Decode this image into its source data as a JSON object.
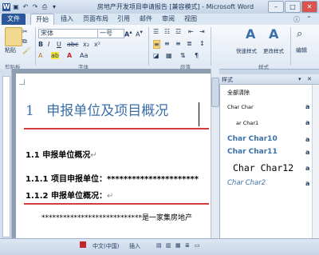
{
  "window": {
    "title": "房地产开发项目申请报告 [兼容模式] - Microsoft Word"
  },
  "quick_access": [
    "word-logo-icon",
    "save-icon",
    "undo-icon",
    "redo-icon",
    "print-icon",
    "customize-icon"
  ],
  "tabs": [
    {
      "label": "文件",
      "active": false
    },
    {
      "label": "开始",
      "active": true
    },
    {
      "label": "插入",
      "active": false
    },
    {
      "label": "页面布局",
      "active": false
    },
    {
      "label": "引用",
      "active": false
    },
    {
      "label": "邮件",
      "active": false
    },
    {
      "label": "审阅",
      "active": false
    },
    {
      "label": "视图",
      "active": false
    }
  ],
  "ribbon": {
    "clipboard": {
      "label": "剪贴板",
      "paste": "粘贴"
    },
    "font": {
      "label": "字体",
      "font_name": "宋体",
      "font_size": "一号"
    },
    "paragraph": {
      "label": "段落"
    },
    "styles": {
      "quick_styles": "快速样式",
      "change_styles": "更改样式",
      "label": "样式"
    },
    "editing": {
      "label": "编辑"
    }
  },
  "document": {
    "heading1_num": "1",
    "heading1_text": "申报单位及项目概况",
    "heading2": "1.1   申报单位概况",
    "heading3a": "1.1.1 项目申报单位：**********************",
    "heading3b": "1.1.2 申报单位概况：",
    "body": "****************************是一家集房地产",
    "para_mark": "↵"
  },
  "styles_pane": {
    "title": "样式",
    "clear_all": "全部清除",
    "items": [
      {
        "label": "Char Char",
        "mark": "a"
      },
      {
        "label": "ar Char1",
        "mark": "a"
      },
      {
        "label": "Char Char10",
        "mark": "a"
      },
      {
        "label": "Char Char11",
        "mark": "a"
      },
      {
        "label": "Char Char12",
        "mark": "a"
      },
      {
        "label": "Char Char2",
        "mark": "a"
      }
    ]
  },
  "statusbar": {
    "language": "中文(中国)",
    "mode": "插入"
  },
  "colors": {
    "file_tab": "#2b579a",
    "heading": "#3a6fa8",
    "underline": "#d13b3b",
    "style_blue": "#3a6fa8"
  }
}
